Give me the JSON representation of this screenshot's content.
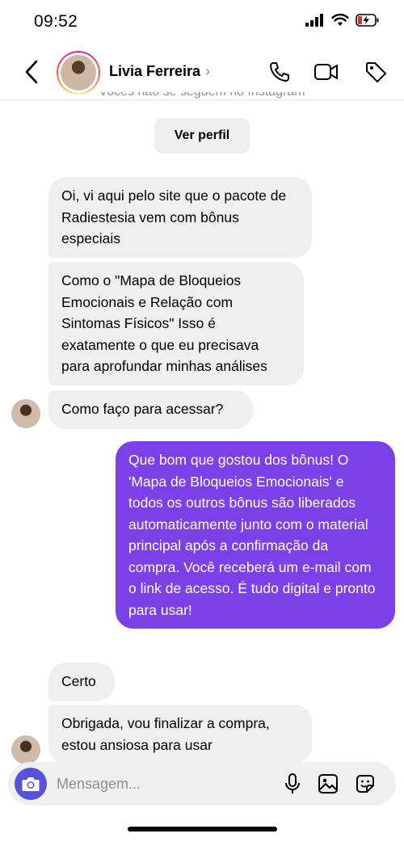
{
  "status": {
    "time": "09:52"
  },
  "header": {
    "contact_name": "Livia Ferreira",
    "chevron": "›"
  },
  "banner": {
    "note": "Vocês não se seguem no Instagram",
    "profile_button": "Ver perfil"
  },
  "messages": [
    {
      "direction": "in",
      "text": "Oi, vi aqui pelo site  que o pacote de Radiestesia vem com bônus especiais"
    },
    {
      "direction": "in",
      "text": "Como o \"Mapa de Bloqueios Emocionais e Relação com Sintomas Físicos\" Isso é exatamente o que eu precisava para aprofundar minhas análises"
    },
    {
      "direction": "in",
      "text": "Como faço para acessar?"
    },
    {
      "direction": "out",
      "text": "Que bom que gostou dos bônus! O 'Mapa de Bloqueios Emocionais' e todos os outros bônus são liberados automaticamente junto com o material principal após a confirmação da compra. Você receberá um e-mail com o link de acesso. É tudo digital e pronto para usar!"
    },
    {
      "direction": "in",
      "text": "Certo"
    },
    {
      "direction": "in",
      "text": "Obrigada, vou finalizar a compra, estou ansiosa para usar"
    }
  ],
  "composer": {
    "placeholder": "Mensagem..."
  },
  "colors": {
    "outgoing_bubble": "#7c40e8",
    "incoming_bubble": "#efefef",
    "camera_button": "#5851db"
  },
  "icons": [
    "back-arrow-icon",
    "phone-icon",
    "video-camera-icon",
    "tag-icon",
    "camera-icon",
    "microphone-icon",
    "gallery-icon",
    "sticker-icon"
  ]
}
